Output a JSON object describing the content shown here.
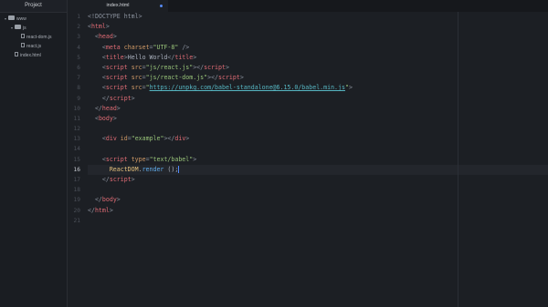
{
  "sidebar": {
    "title": "Project",
    "tree": [
      {
        "name": "www",
        "type": "folder",
        "depth": 0
      },
      {
        "name": "js",
        "type": "folder",
        "depth": 1
      },
      {
        "name": "react-dom.js",
        "type": "file",
        "depth": 2
      },
      {
        "name": "react.js",
        "type": "file",
        "depth": 2
      },
      {
        "name": "index.html",
        "type": "file",
        "depth": 1
      }
    ]
  },
  "editor": {
    "tab_label": "index.html",
    "current_line": 16,
    "lines": [
      [
        [
          "p",
          "<!DOCTYPE html>"
        ]
      ],
      [
        [
          "p",
          "<"
        ],
        [
          "t",
          "html"
        ],
        [
          "p",
          ">"
        ]
      ],
      [
        [
          "x",
          "  "
        ],
        [
          "p",
          "<"
        ],
        [
          "t",
          "head"
        ],
        [
          "p",
          ">"
        ]
      ],
      [
        [
          "x",
          "    "
        ],
        [
          "p",
          "<"
        ],
        [
          "t",
          "meta"
        ],
        [
          "x",
          " "
        ],
        [
          "a",
          "charset"
        ],
        [
          "p",
          "="
        ],
        [
          "s",
          "\"UTF-8\""
        ],
        [
          "x",
          " "
        ],
        [
          "p",
          "/>"
        ]
      ],
      [
        [
          "x",
          "    "
        ],
        [
          "p",
          "<"
        ],
        [
          "t",
          "title"
        ],
        [
          "p",
          ">"
        ],
        [
          "x",
          "Hello World"
        ],
        [
          "p",
          "</"
        ],
        [
          "t",
          "title"
        ],
        [
          "p",
          ">"
        ]
      ],
      [
        [
          "x",
          "    "
        ],
        [
          "p",
          "<"
        ],
        [
          "t",
          "script"
        ],
        [
          "x",
          " "
        ],
        [
          "a",
          "src"
        ],
        [
          "p",
          "="
        ],
        [
          "s",
          "\"js/react.js\""
        ],
        [
          "p",
          "></"
        ],
        [
          "t",
          "script"
        ],
        [
          "p",
          ">"
        ]
      ],
      [
        [
          "x",
          "    "
        ],
        [
          "p",
          "<"
        ],
        [
          "t",
          "script"
        ],
        [
          "x",
          " "
        ],
        [
          "a",
          "src"
        ],
        [
          "p",
          "="
        ],
        [
          "s",
          "\"js/react-dom.js\""
        ],
        [
          "p",
          "></"
        ],
        [
          "t",
          "script"
        ],
        [
          "p",
          ">"
        ]
      ],
      [
        [
          "x",
          "    "
        ],
        [
          "p",
          "<"
        ],
        [
          "t",
          "script"
        ],
        [
          "x",
          " "
        ],
        [
          "a",
          "src"
        ],
        [
          "p",
          "="
        ],
        [
          "s",
          "\""
        ],
        [
          "u",
          "https://unpkg.com/babel-standalone@6.15.0/babel.min.js"
        ],
        [
          "s",
          "\""
        ],
        [
          "p",
          ">"
        ]
      ],
      [
        [
          "x",
          "    "
        ],
        [
          "p",
          "</"
        ],
        [
          "t",
          "script"
        ],
        [
          "p",
          ">"
        ]
      ],
      [
        [
          "x",
          "  "
        ],
        [
          "p",
          "</"
        ],
        [
          "t",
          "head"
        ],
        [
          "p",
          ">"
        ]
      ],
      [
        [
          "x",
          "  "
        ],
        [
          "p",
          "<"
        ],
        [
          "t",
          "body"
        ],
        [
          "p",
          ">"
        ]
      ],
      [],
      [
        [
          "x",
          "    "
        ],
        [
          "p",
          "<"
        ],
        [
          "t",
          "div"
        ],
        [
          "x",
          " "
        ],
        [
          "a",
          "id"
        ],
        [
          "p",
          "="
        ],
        [
          "s",
          "\"example\""
        ],
        [
          "p",
          "></"
        ],
        [
          "t",
          "div"
        ],
        [
          "p",
          ">"
        ]
      ],
      [],
      [
        [
          "x",
          "    "
        ],
        [
          "p",
          "<"
        ],
        [
          "t",
          "script"
        ],
        [
          "x",
          " "
        ],
        [
          "a",
          "type"
        ],
        [
          "p",
          "="
        ],
        [
          "s",
          "\"text/babel\""
        ],
        [
          "p",
          ">"
        ]
      ],
      [
        [
          "x",
          "      "
        ],
        [
          "o",
          "ReactDOM"
        ],
        [
          "x",
          "."
        ],
        [
          "f",
          "render"
        ],
        [
          "x",
          " ();"
        ]
      ],
      [
        [
          "x",
          "    "
        ],
        [
          "p",
          "</"
        ],
        [
          "t",
          "script"
        ],
        [
          "p",
          ">"
        ]
      ],
      [],
      [
        [
          "x",
          "  "
        ],
        [
          "p",
          "</"
        ],
        [
          "t",
          "body"
        ],
        [
          "p",
          ">"
        ]
      ],
      [
        [
          "p",
          "</"
        ],
        [
          "t",
          "html"
        ],
        [
          "p",
          ">"
        ]
      ],
      []
    ]
  }
}
